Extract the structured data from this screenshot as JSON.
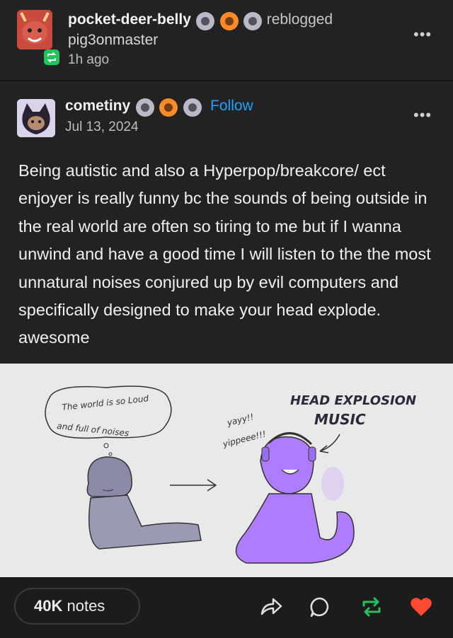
{
  "reblog": {
    "reblogger": "pocket-deer-belly",
    "action": "reblogged",
    "source": "pig3onmaster",
    "time": "1h ago"
  },
  "post": {
    "author": "cometiny",
    "follow_label": "Follow",
    "date": "Jul 13, 2024",
    "text": "Being autistic and also a Hyperpop/breakcore/ ect enjoyer is really funny bc the sounds of being outside in the real world are often so tiring to me but if I wanna unwind and have a good time I will listen to the the most unnatural noises conjured up by evil computers and specifically designed to make your head explode. awesome"
  },
  "illustration": {
    "thought_line1": "The world is so Loud",
    "thought_line2": "and full of noises",
    "title_line1": "HEAD EXPLOSION",
    "title_line2": "MUSIC",
    "exclaim_line1": "yayy!!",
    "exclaim_line2": "yippeee!!!"
  },
  "footer": {
    "notes_count": "40K",
    "notes_label": "notes"
  },
  "colors": {
    "background": "#222222",
    "follow": "#1ea0ff",
    "reblog_green": "#25c15a",
    "like_red": "#ff4930"
  }
}
